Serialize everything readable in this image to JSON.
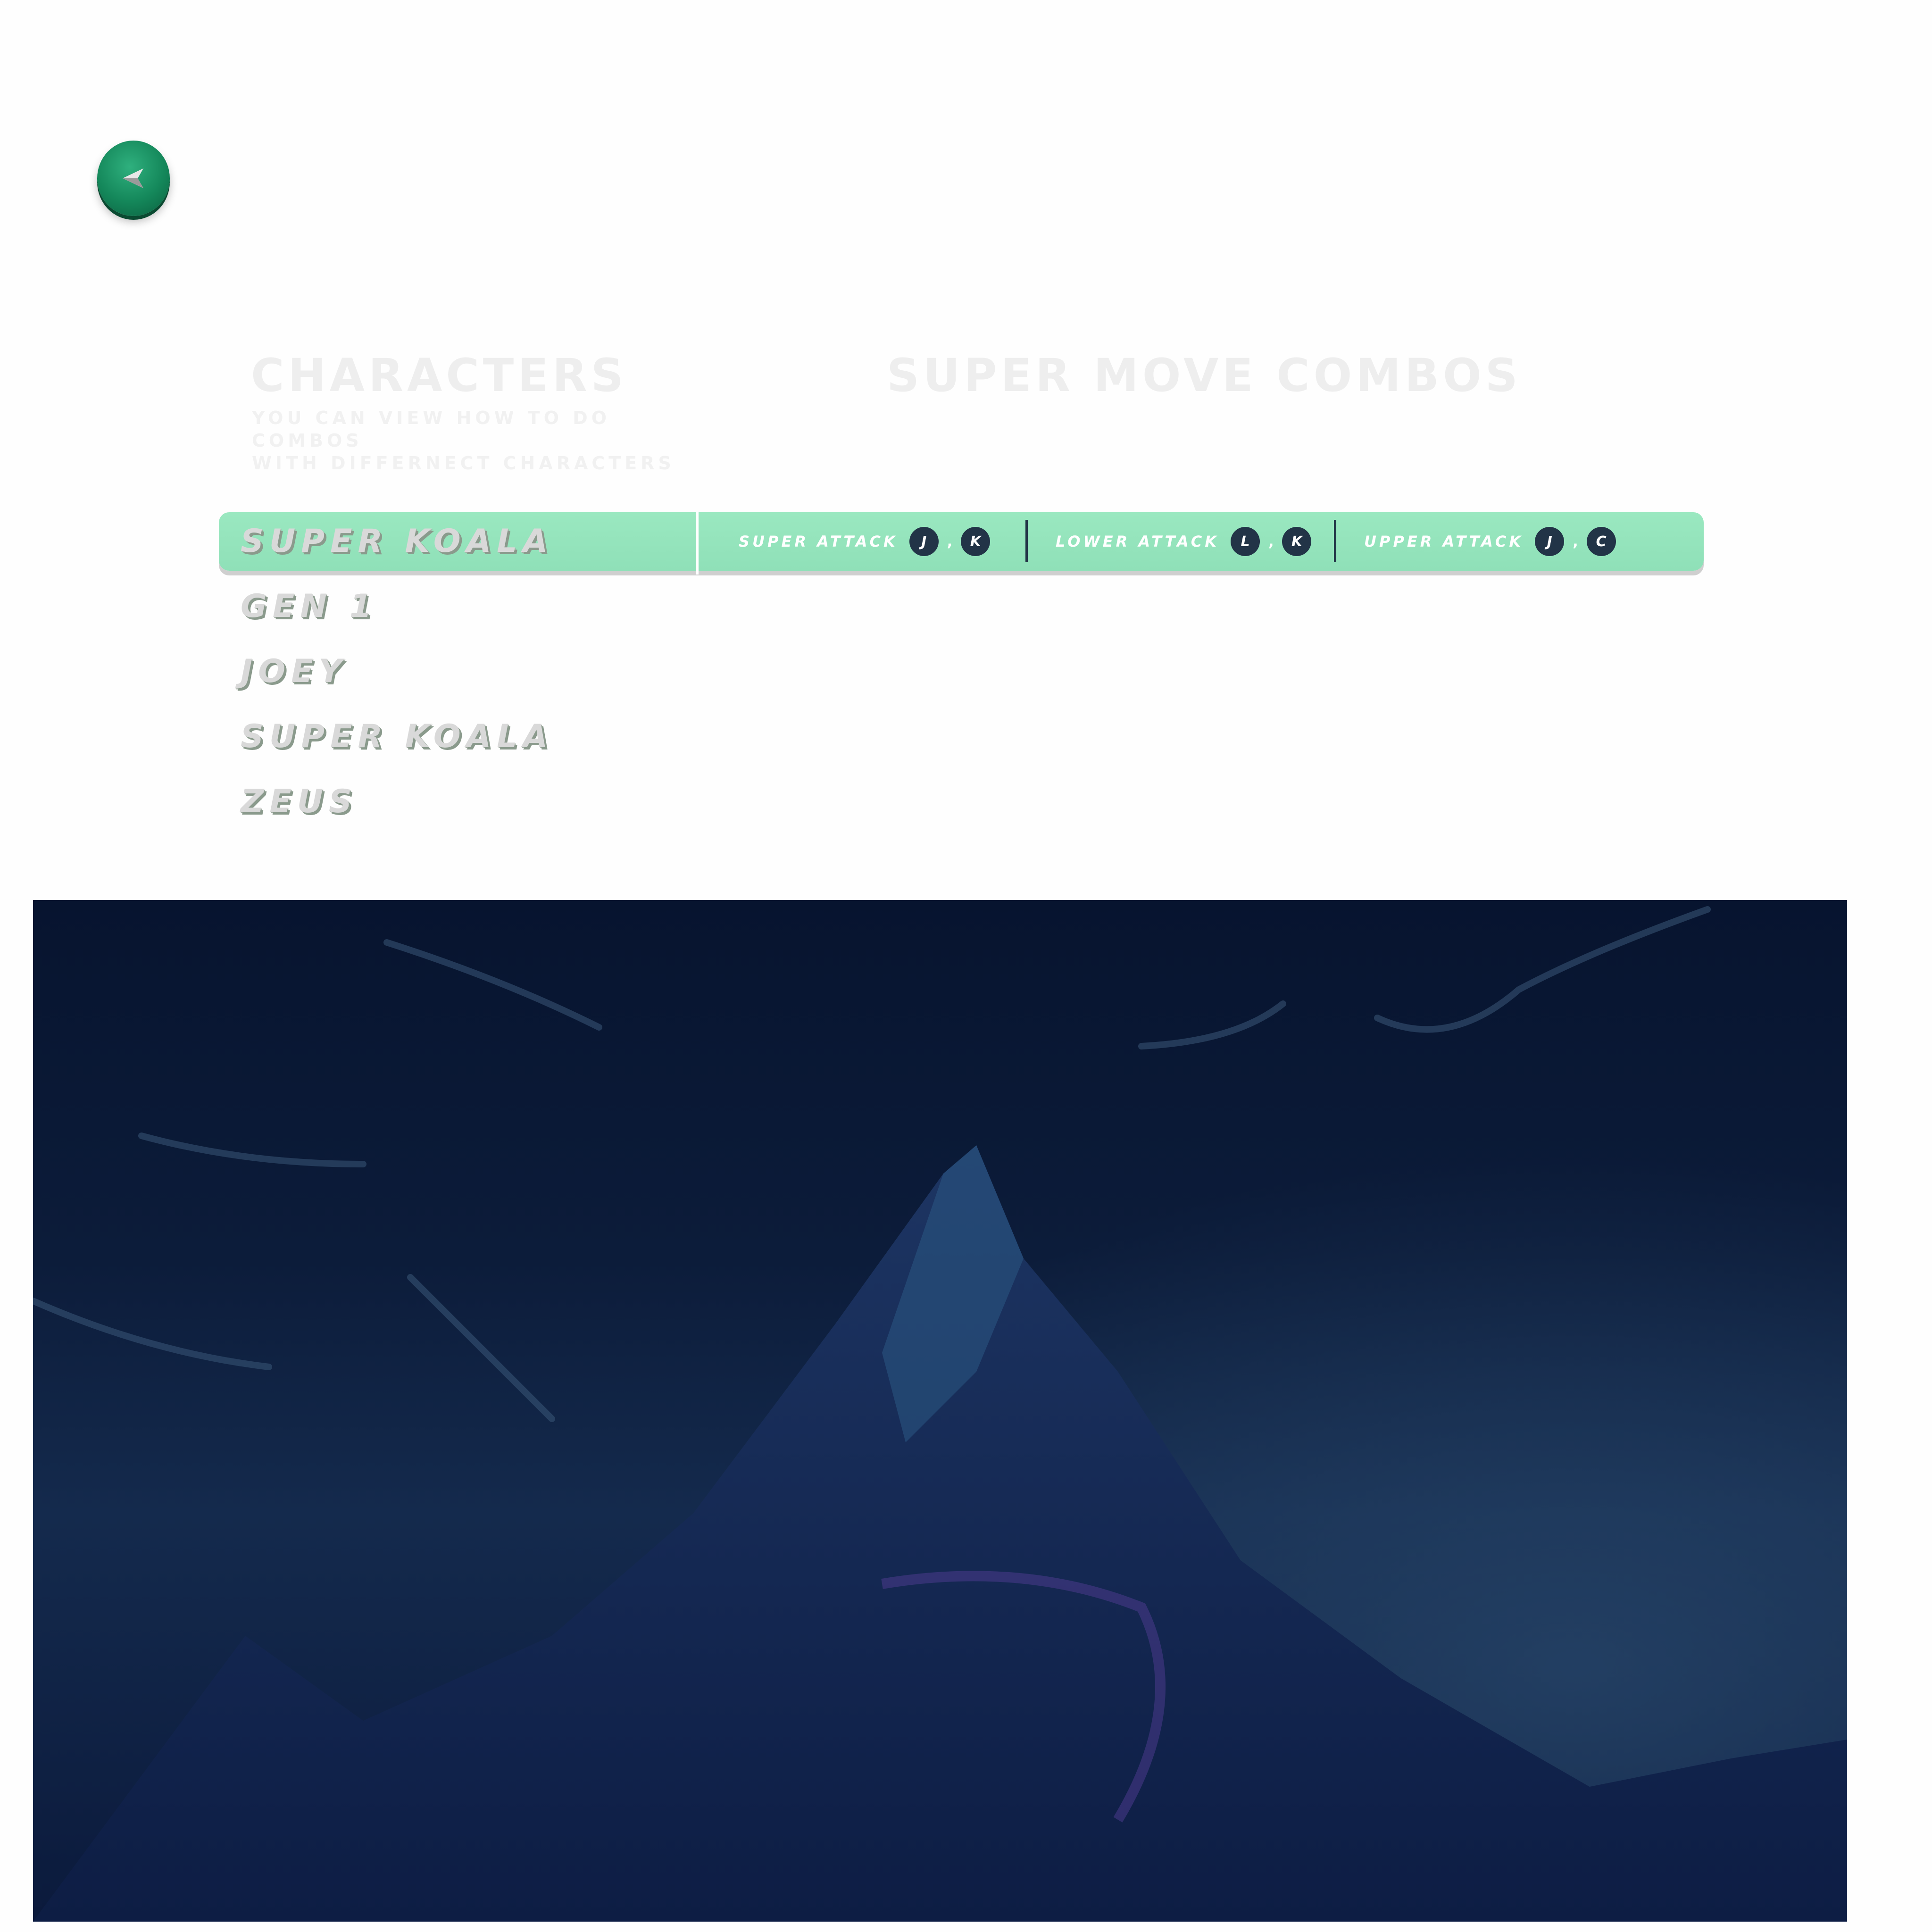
{
  "header": {
    "back_icon": "back-arrow-icon"
  },
  "characters_section": {
    "title": "CHARACTERS",
    "subtitle_line1": "YOU CAN VIEW HOW TO DO COMBOS",
    "subtitle_line2": "WITH DIFFERNECT CHARACTERS"
  },
  "combos_section": {
    "title": "SUPER MOVE COMBOS"
  },
  "character_list": [
    {
      "name": "SUPER KOALA",
      "selected": true
    },
    {
      "name": "GEN 1",
      "selected": false
    },
    {
      "name": "JOEY",
      "selected": false
    },
    {
      "name": "SUPER KOALA",
      "selected": false
    },
    {
      "name": "ZEUS",
      "selected": false
    }
  ],
  "combos": [
    {
      "label": "SUPER ATTACK",
      "key1": "J",
      "separator": ",",
      "key2": "K"
    },
    {
      "label": "LOWER ATTACK",
      "key1": "L",
      "separator": ",",
      "key2": "K"
    },
    {
      "label": "UPPER ATTACK",
      "key1": "J",
      "separator": ",",
      "key2": "C"
    }
  ],
  "colors": {
    "selected_row": "#95e5bc",
    "key_badge": "#223447",
    "back_button": "#14875a",
    "background_art": "#0c1c3a"
  }
}
